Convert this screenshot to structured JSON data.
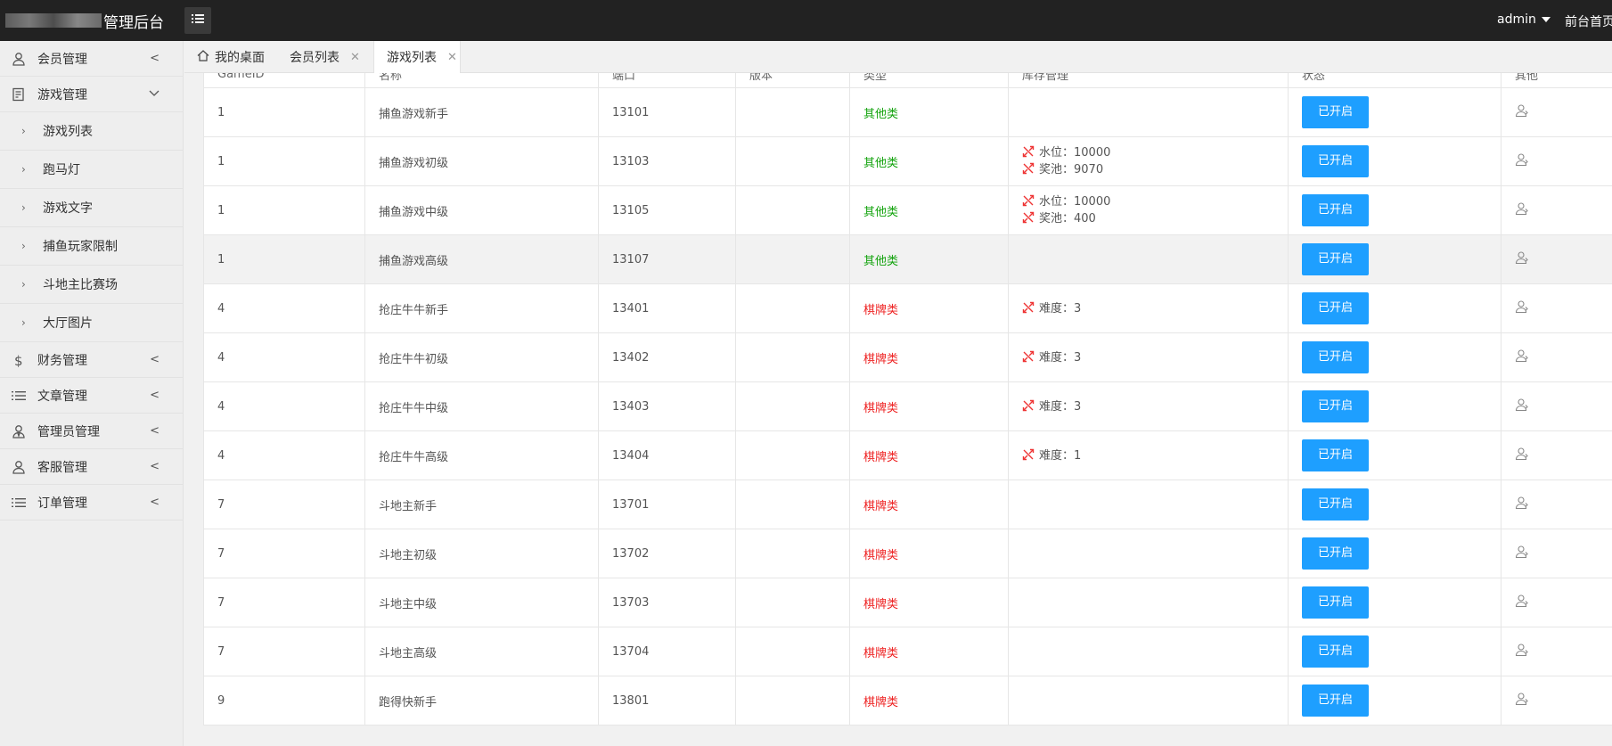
{
  "header": {
    "app_title": "管理后台",
    "user": "admin",
    "front_link": "前台首页"
  },
  "sidebar": {
    "items": [
      {
        "label": "会员管理",
        "icon": "user-icon",
        "expanded": false
      },
      {
        "label": "游戏管理",
        "icon": "game-icon",
        "expanded": true,
        "children": [
          "游戏列表",
          "跑马灯",
          "游戏文字",
          "捕鱼玩家限制",
          "斗地主比赛场",
          "大厅图片"
        ]
      },
      {
        "label": "财务管理",
        "icon": "dollar-icon",
        "expanded": false
      },
      {
        "label": "文章管理",
        "icon": "list-icon",
        "expanded": false
      },
      {
        "label": "管理员管理",
        "icon": "admin-icon",
        "expanded": false
      },
      {
        "label": "客服管理",
        "icon": "service-icon",
        "expanded": false
      },
      {
        "label": "订单管理",
        "icon": "list-icon",
        "expanded": false
      }
    ]
  },
  "tabs": [
    {
      "label": "我的桌面",
      "icon": "home-icon",
      "active": false
    },
    {
      "label": "会员列表",
      "closable": true,
      "active": false
    },
    {
      "label": "游戏列表",
      "closable": true,
      "active": true
    }
  ],
  "table": {
    "columns": [
      "GameID",
      "名称",
      "端口",
      "版本",
      "类型",
      "库存管理",
      "状态",
      "其他"
    ],
    "type_colors": {
      "其他类": "#13a30d",
      "棋牌类": "#ee2222"
    },
    "status_button_color": "#1e9fff",
    "rows": [
      {
        "gameid": "1",
        "name": "捕鱼游戏新手",
        "port": "13101",
        "version": "",
        "type": "其他类",
        "stock": [],
        "status": "已开启"
      },
      {
        "gameid": "1",
        "name": "捕鱼游戏初级",
        "port": "13103",
        "version": "",
        "type": "其他类",
        "stock": [
          "水位：10000",
          "奖池：9070"
        ],
        "status": "已开启"
      },
      {
        "gameid": "1",
        "name": "捕鱼游戏中级",
        "port": "13105",
        "version": "",
        "type": "其他类",
        "stock": [
          "水位：10000",
          "奖池：400"
        ],
        "status": "已开启"
      },
      {
        "gameid": "1",
        "name": "捕鱼游戏高级",
        "port": "13107",
        "version": "",
        "type": "其他类",
        "stock": [],
        "status": "已开启",
        "highlighted": true
      },
      {
        "gameid": "4",
        "name": "抢庄牛牛新手",
        "port": "13401",
        "version": "",
        "type": "棋牌类",
        "stock": [
          "难度：3"
        ],
        "status": "已开启"
      },
      {
        "gameid": "4",
        "name": "抢庄牛牛初级",
        "port": "13402",
        "version": "",
        "type": "棋牌类",
        "stock": [
          "难度：3"
        ],
        "status": "已开启"
      },
      {
        "gameid": "4",
        "name": "抢庄牛牛中级",
        "port": "13403",
        "version": "",
        "type": "棋牌类",
        "stock": [
          "难度：3"
        ],
        "status": "已开启"
      },
      {
        "gameid": "4",
        "name": "抢庄牛牛高级",
        "port": "13404",
        "version": "",
        "type": "棋牌类",
        "stock": [
          "难度：1"
        ],
        "status": "已开启"
      },
      {
        "gameid": "7",
        "name": "斗地主新手",
        "port": "13701",
        "version": "",
        "type": "棋牌类",
        "stock": [],
        "status": "已开启"
      },
      {
        "gameid": "7",
        "name": "斗地主初级",
        "port": "13702",
        "version": "",
        "type": "棋牌类",
        "stock": [],
        "status": "已开启"
      },
      {
        "gameid": "7",
        "name": "斗地主中级",
        "port": "13703",
        "version": "",
        "type": "棋牌类",
        "stock": [],
        "status": "已开启"
      },
      {
        "gameid": "7",
        "name": "斗地主高级",
        "port": "13704",
        "version": "",
        "type": "棋牌类",
        "stock": [],
        "status": "已开启"
      },
      {
        "gameid": "9",
        "name": "跑得快新手",
        "port": "13801",
        "version": "",
        "type": "棋牌类",
        "stock": [],
        "status": "已开启"
      }
    ]
  }
}
